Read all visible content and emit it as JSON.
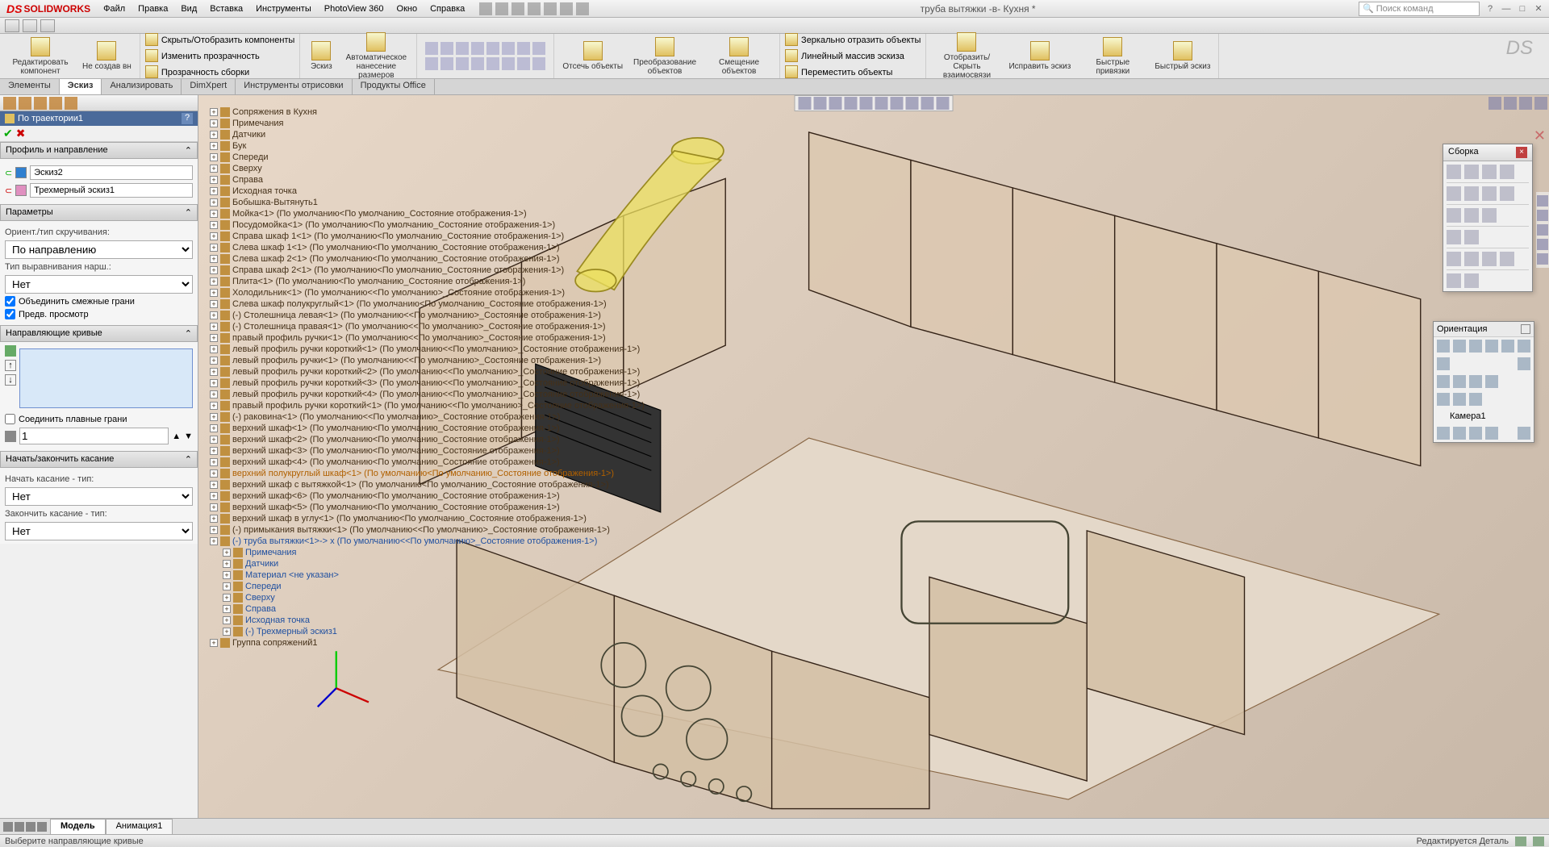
{
  "app": {
    "logo": "SOLIDWORKS",
    "doc_title": "труба вытяжки -в- Кухня *"
  },
  "menu": [
    "Файл",
    "Правка",
    "Вид",
    "Вставка",
    "Инструменты",
    "PhotoView 360",
    "Окно",
    "Справка"
  ],
  "search": {
    "placeholder": "Поиск команд"
  },
  "ribbon": {
    "edit_component": "Редактировать\nкомпонент",
    "no_create": "Не\nсоздав\nвн",
    "visibility": {
      "a": "Скрыть/Отобразить компоненты",
      "b": "Изменить прозрачность",
      "c": "Прозрачность сборки"
    },
    "sketch": "Эскиз",
    "auto_dim": "Автоматическое\nнанесение\nразмеров",
    "trim": "Отсечь\nобъекты",
    "convert": "Преобразование\nобъектов",
    "offset": "Смещение\nобъектов",
    "mirror": {
      "a": "Зеркально отразить объекты",
      "b": "Линейный массив эскиза",
      "c": "Переместить объекты"
    },
    "showhide": "Отобразить/Скрыть\nвзаимосвязи",
    "repair": "Исправить\nэскиз",
    "quicksnap": "Быстрые\nпривязки",
    "rapid": "Быстрый\nэскиз"
  },
  "tabs": [
    "Элементы",
    "Эскиз",
    "Анализировать",
    "DimXpert",
    "Инструменты отрисовки",
    "Продукты Office"
  ],
  "tabs_active": 1,
  "prop_manager": {
    "title": "По траектории1",
    "section_profile": "Профиль и направление",
    "profile": "Эскиз2",
    "direction": "Трехмерный эскиз1",
    "section_params": "Параметры",
    "orient_label": "Ориент./тип скручивания:",
    "orient_value": "По направлению",
    "align_label": "Тип выравнивания нарш.:",
    "align_value": "Нет",
    "merge": "Объединить смежные грани",
    "preview": "Предв. просмотр",
    "section_guides": "Направляющие кривые",
    "merge_smooth": "Соединить плавные грани",
    "spin_value": "1",
    "section_tangency": "Начать/закончить касание",
    "start_label": "Начать касание - тип:",
    "start_value": "Нет",
    "end_label": "Закончить касание - тип:",
    "end_value": "Нет"
  },
  "tree": [
    "Сопряжения в Кухня",
    "Примечания",
    "Датчики",
    "Бук",
    "Спереди",
    "Сверху",
    "Справа",
    "Исходная точка",
    "Бобышка-Вытянуть1",
    "Мойка<1> (По умолчанию<По умолчанию_Состояние отображения-1>)",
    "Посудомойка<1> (По умолчанию<По умолчанию_Состояние отображения-1>)",
    "Справа шкаф 1<1> (По умолчанию<По умолчанию_Состояние отображения-1>)",
    "Слева шкаф 1<1> (По умолчанию<По умолчанию_Состояние отображения-1>)",
    "Слева шкаф 2<1> (По умолчанию<По умолчанию_Состояние отображения-1>)",
    "Справа шкаф 2<1> (По умолчанию<По умолчанию_Состояние отображения-1>)",
    "Плита<1> (По умолчанию<По умолчанию_Состояние отображения-1>)",
    "Холодильник<1> (По умолчанию<<По умолчанию>_Состояние отображения-1>)",
    "Слева шкаф полукруглый<1> (По умолчанию<По умолчанию_Состояние отображения-1>)",
    "(-) Столешница левая<1> (По умолчанию<<По умолчанию>_Состояние отображения-1>)",
    "(-) Столешница правая<1> (По умолчанию<<По умолчанию>_Состояние отображения-1>)",
    "правый профиль ручки<1> (По умолчанию<<По умолчанию>_Состояние отображения-1>)",
    "левый профиль ручки короткий<1> (По умолчанию<<По умолчанию>_Состояние отображения-1>)",
    "левый профиль ручки<1> (По умолчанию<<По умолчанию>_Состояние отображения-1>)",
    "левый профиль ручки короткий<2> (По умолчанию<<По умолчанию>_Состояние отображения-1>)",
    "левый профиль ручки короткий<3> (По умолчанию<<По умолчанию>_Состояние отображения-1>)",
    "левый профиль ручки короткий<4> (По умолчанию<<По умолчанию>_Состояние отображения-1>)",
    "правый профиль ручки короткий<1> (По умолчанию<<По умолчанию>_Состояние отображения-1>)",
    "(-) раковина<1> (По умолчанию<<По умолчанию>_Состояние отображения-1>)",
    "верхний шкаф<1> (По умолчанию<По умолчанию_Состояние отображения-1>)",
    "верхний шкаф<2> (По умолчанию<По умолчанию_Состояние отображения-1>)",
    "верхний шкаф<3> (По умолчанию<По умолчанию_Состояние отображения-1>)",
    "верхний шкаф<4> (По умолчанию<По умолчанию_Состояние отображения-1>)"
  ],
  "tree_highlight": "верхний полукруглый шкаф<1> (По умолчанию<По умолчанию_Состояние отображения-1>)",
  "tree2": [
    "верхний шкаф с вытяжкой<1> (По умолчанию<По умолчанию_Состояние отображения-1>)",
    "верхний шкаф<6> (По умолчанию<По умолчанию_Состояние отображения-1>)",
    "верхний шкаф<5> (По умолчанию<По умолчанию_Состояние отображения-1>)",
    "верхний шкаф в углу<1> (По умолчанию<По умолчанию_Состояние отображения-1>)",
    "(-) примыкания вытяжки<1> (По умолчанию<<По умолчанию>_Состояние отображения-1>)"
  ],
  "tree_link": "(-) труба вытяжки<1>-> x (По умолчанию<<По умолчанию>_Состояние отображения-1>)",
  "tree3": [
    "Примечания",
    "Датчики",
    "Материал <не указан>",
    "Спереди",
    "Сверху",
    "Справа",
    "Исходная точка"
  ],
  "tree_blue": "(-) Трехмерный эскиз1",
  "tree4": "Группа сопряжений1",
  "float_assembly": {
    "title": "Сборка"
  },
  "float_orient": {
    "title": "Ориентация",
    "camera": "Камера1"
  },
  "bottom_tabs": [
    "Модель",
    "Анимация1"
  ],
  "status": {
    "left": "Выберите направляющие кривые",
    "right": "Редактируется Деталь"
  }
}
